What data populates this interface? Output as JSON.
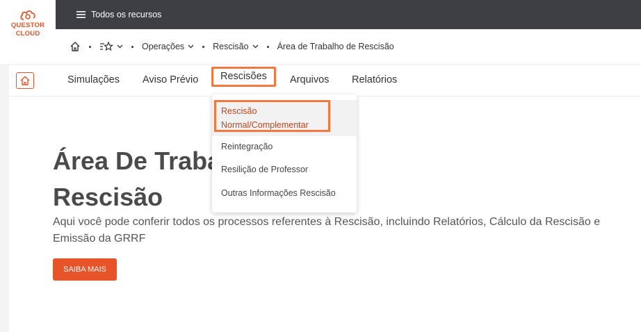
{
  "logo": {
    "line1": "QUESTOR",
    "line2": "CLOUD"
  },
  "topbar": {
    "menu_label": "Todos os recursos"
  },
  "breadcrumb": {
    "items": [
      {
        "label": "Operações"
      },
      {
        "label": "Rescisão"
      },
      {
        "label": "Área de Trabalho de Rescisão"
      }
    ]
  },
  "nav": {
    "tabs": [
      {
        "label": "Simulações"
      },
      {
        "label": "Aviso Prévio"
      },
      {
        "label": "Rescisões"
      },
      {
        "label": "Arquivos"
      },
      {
        "label": "Relatórios"
      }
    ],
    "active": "Rescisões"
  },
  "dropdown": {
    "items": [
      {
        "label": "Rescisão Normal/Complementar",
        "line1": "Rescisão",
        "line2": "Normal/Complementar"
      },
      {
        "label": "Reintegração"
      },
      {
        "label": "Resilição de Professor"
      },
      {
        "label": "Outras Informações Rescisão"
      }
    ]
  },
  "hero": {
    "title_line1": "Área De Traba",
    "title_line2": "Rescisão",
    "description": "Aqui você pode conferir todos os processos referentes à Rescisão, incluindo Relatórios, Cálculo da Rescisão e Emissão da GRRF",
    "button_label": "SAIBA MAIS"
  },
  "colors": {
    "accent": "#e8542a",
    "topbar": "#3e3f44",
    "highlight_border": "#f2783f"
  }
}
